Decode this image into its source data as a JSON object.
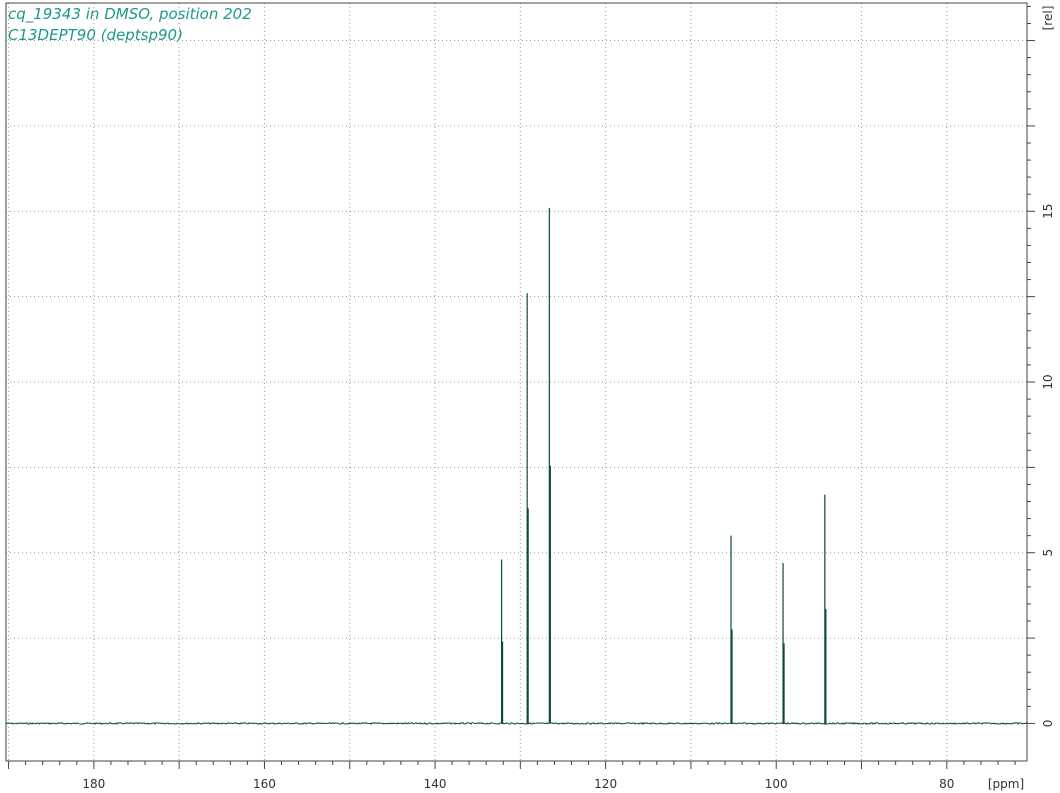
{
  "header": {
    "title_line1": "cq_19343 in DMSO, position 202",
    "title_line2": "C13DEPT90 (deptsp90)"
  },
  "colors": {
    "spectrum": "#0b4a44",
    "title": "#1a9a8a",
    "grid": "#9a9a9a",
    "axis": "#444444"
  },
  "chart_data": {
    "type": "line",
    "title": "cq_19343 in DMSO, position 202",
    "subtitle": "C13DEPT90 (deptsp90)",
    "xlabel": "[ppm]",
    "ylabel": "[rel]",
    "x_reversed": true,
    "xlim": [
      190.3,
      70.6
    ],
    "ylim": [
      -1.1,
      21.1
    ],
    "x_ticks": [
      180,
      160,
      140,
      120,
      100,
      80
    ],
    "y_ticks": [
      0,
      5,
      10,
      15
    ],
    "grid": true,
    "series": [
      {
        "peaks": [
          {
            "x": 132.2,
            "y": 4.8
          },
          {
            "x": 129.2,
            "y": 12.6
          },
          {
            "x": 126.6,
            "y": 15.1
          },
          {
            "x": 105.3,
            "y": 5.5
          },
          {
            "x": 99.2,
            "y": 4.7
          },
          {
            "x": 94.3,
            "y": 6.7
          }
        ]
      }
    ]
  }
}
